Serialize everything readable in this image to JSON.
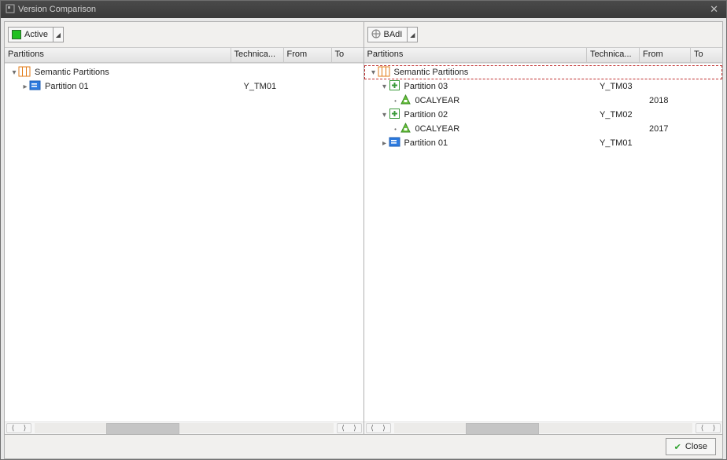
{
  "window": {
    "title": "Version Comparison"
  },
  "left": {
    "selector_label": "Active",
    "headers": {
      "partitions": "Partitions",
      "technical": "Technica...",
      "from": "From",
      "to": "To"
    },
    "rows": [
      {
        "level": 0,
        "expander": "open",
        "icon": "semantic-partitions",
        "label": "Semantic Partitions",
        "tech": "",
        "from": "",
        "to": "",
        "changed": false
      },
      {
        "level": 1,
        "expander": "closed",
        "icon": "blue",
        "label": "Partition 01",
        "tech": "Y_TM01",
        "from": "",
        "to": "",
        "changed": false
      }
    ],
    "scroll_thumb": {
      "left_pct": 24,
      "width_pct": 24
    }
  },
  "right": {
    "selector_label": "BAdI",
    "headers": {
      "partitions": "Partitions",
      "technical": "Technica...",
      "from": "From",
      "to": "To"
    },
    "rows": [
      {
        "level": 0,
        "expander": "open",
        "icon": "semantic-partitions",
        "label": "Semantic Partitions",
        "tech": "",
        "from": "",
        "to": "",
        "changed": true
      },
      {
        "level": 1,
        "expander": "open",
        "icon": "plus",
        "label": "Partition 03",
        "tech": "Y_TM03",
        "from": "",
        "to": "",
        "changed": false
      },
      {
        "level": 2,
        "expander": "leaf",
        "icon": "cal",
        "label": "0CALYEAR",
        "tech": "",
        "from": "2018",
        "to": "",
        "changed": false
      },
      {
        "level": 1,
        "expander": "open",
        "icon": "plus",
        "label": "Partition 02",
        "tech": "Y_TM02",
        "from": "",
        "to": "",
        "changed": false
      },
      {
        "level": 2,
        "expander": "leaf",
        "icon": "cal",
        "label": "0CALYEAR",
        "tech": "",
        "from": "2017",
        "to": "",
        "changed": false
      },
      {
        "level": 1,
        "expander": "closed",
        "icon": "blue",
        "label": "Partition 01",
        "tech": "Y_TM01",
        "from": "",
        "to": "",
        "changed": false
      }
    ],
    "scroll_thumb": {
      "left_pct": 24,
      "width_pct": 24
    }
  },
  "footer": {
    "close_label": "Close"
  }
}
